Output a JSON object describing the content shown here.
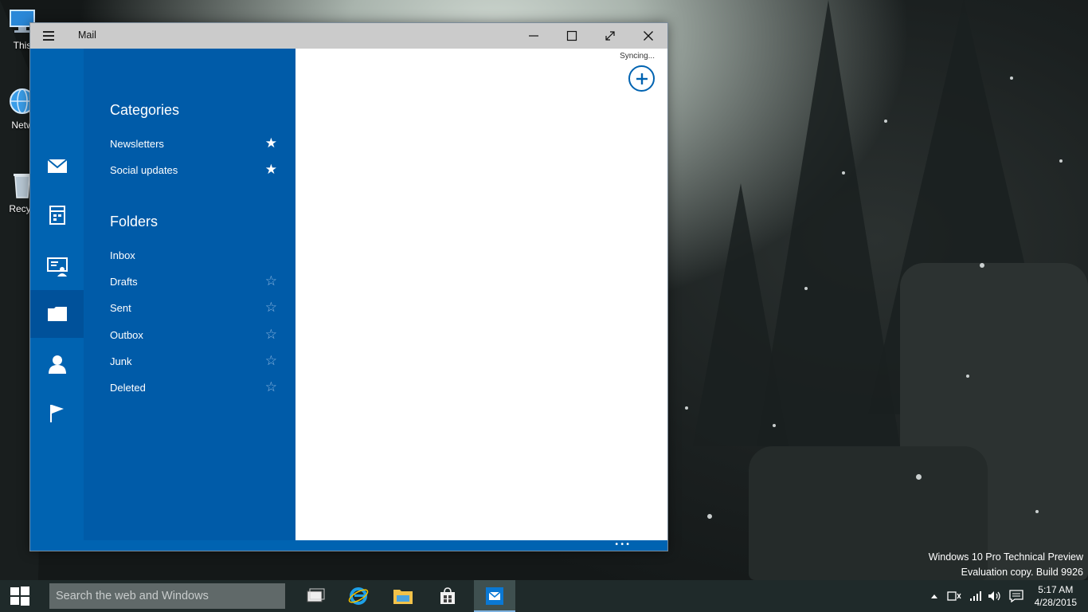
{
  "desktop": {
    "icons": [
      {
        "label": "This"
      },
      {
        "label": "Netw"
      },
      {
        "label": "Recyc"
      }
    ],
    "watermark": {
      "line1": "Windows 10 Pro Technical Preview",
      "line2": "Evaluation copy. Build 9926"
    }
  },
  "window": {
    "title": "Mail",
    "syncing": "Syncing...",
    "rail": [
      {
        "icon": "mail-icon"
      },
      {
        "icon": "calendar-icon"
      },
      {
        "icon": "people-card-icon"
      },
      {
        "icon": "folder-icon",
        "active": true
      },
      {
        "icon": "person-icon"
      },
      {
        "icon": "flag-icon"
      }
    ],
    "categories": {
      "title": "Categories",
      "items": [
        {
          "label": "Newsletters",
          "favorite": true
        },
        {
          "label": "Social updates",
          "favorite": true
        }
      ]
    },
    "folders": {
      "title": "Folders",
      "items": [
        {
          "label": "Inbox",
          "favorite": null
        },
        {
          "label": "Drafts",
          "favorite": false
        },
        {
          "label": "Sent",
          "favorite": false
        },
        {
          "label": "Outbox",
          "favorite": false
        },
        {
          "label": "Junk",
          "favorite": false
        },
        {
          "label": "Deleted",
          "favorite": false
        }
      ]
    },
    "more": "•••"
  },
  "taskbar": {
    "search_placeholder": "Search the web and Windows",
    "clock": {
      "time": "5:17 AM",
      "date": "4/28/2015"
    }
  },
  "colors": {
    "accent": "#0063b1",
    "pane": "#005ba8",
    "taskbar": "#1f2a2a"
  }
}
